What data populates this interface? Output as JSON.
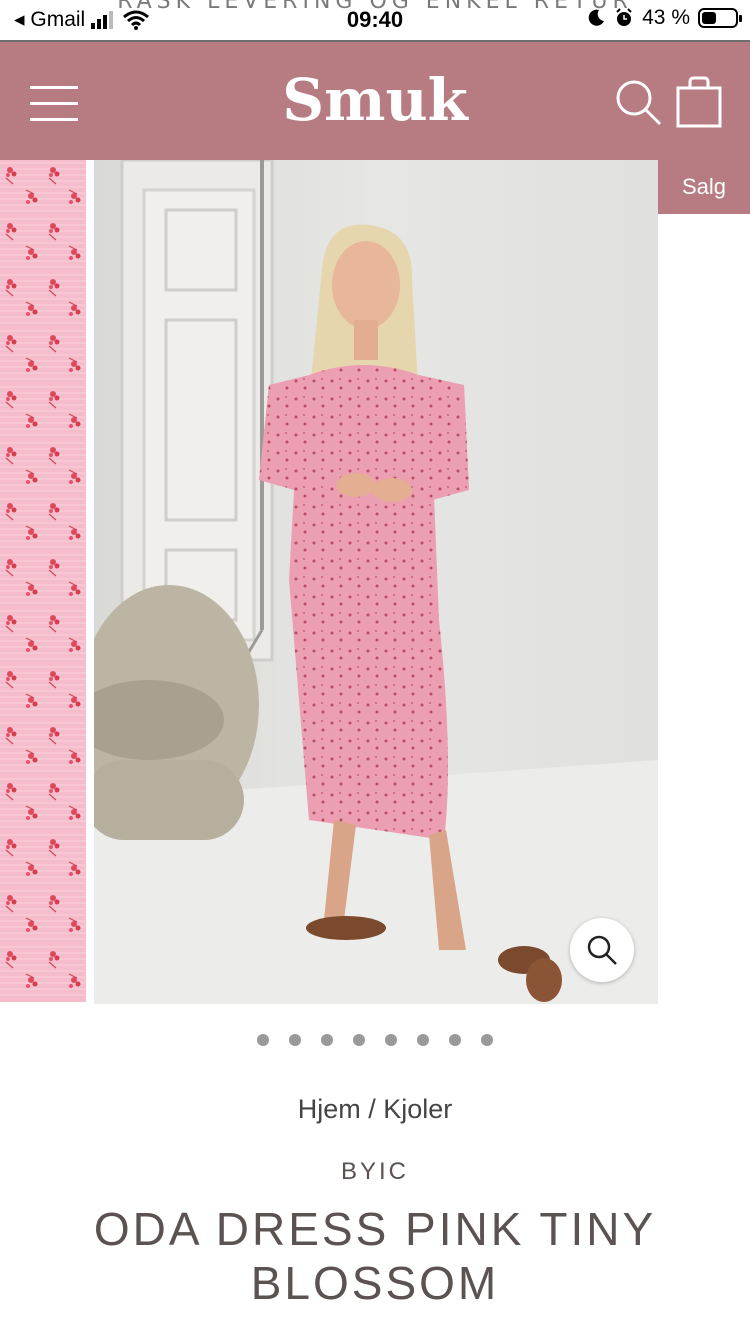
{
  "status_bar": {
    "back_app": "◂ Gmail",
    "time": "09:40",
    "battery_percent": "43 %",
    "battery_level": 0.43
  },
  "promo_text": "RASK LEVERING OG ENKEL RETUR",
  "header": {
    "logo": "Smuk",
    "bg_color": "#b67c82"
  },
  "product": {
    "sale_badge": "Salg",
    "image_count": 8,
    "breadcrumb": {
      "home": "Hjem",
      "separator": "/",
      "category": "Kjoler"
    },
    "vendor": "BYIC",
    "title": "ODA DRESS PINK TINY BLOSSOM"
  },
  "icons": {
    "menu": "hamburger-menu-icon",
    "search": "search-icon",
    "cart": "shopping-bag-icon",
    "zoom": "zoom-icon"
  }
}
